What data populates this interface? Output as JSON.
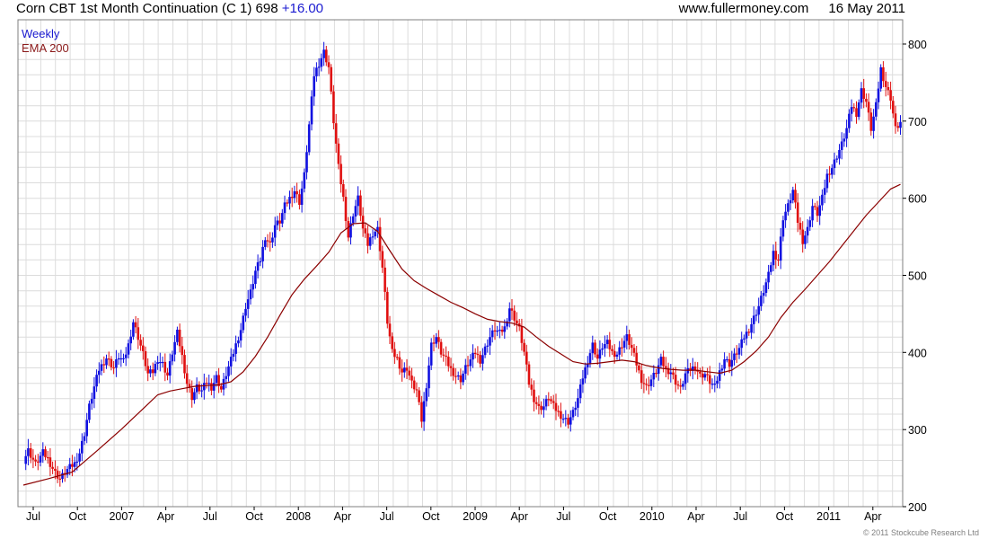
{
  "header": {
    "title": "Corn CBT 1st Month Continuation (C 1)",
    "last": "698",
    "change": "+16.00",
    "site": "www.fullermoney.com",
    "date": "16 May 2011"
  },
  "legend": {
    "period": "Weekly",
    "ema": "EMA 200"
  },
  "copyright": "© 2011 Stockcube Research Ltd",
  "colors": {
    "up": "#1010e0",
    "down": "#e01010",
    "ema": "#8b0000",
    "grid": "#dcdcdc",
    "legend_period": "#1a1ad0",
    "legend_ema": "#8b1a1a"
  },
  "chart_data": {
    "type": "candlestick",
    "ylim": [
      200,
      800
    ],
    "yticks": [
      200,
      300,
      400,
      500,
      600,
      700,
      800
    ],
    "xticks": [
      "Jul",
      "Oct",
      "2007",
      "Apr",
      "Jul",
      "Oct",
      "2008",
      "Apr",
      "Jul",
      "Oct",
      "2009",
      "Apr",
      "Jul",
      "Oct",
      "2010",
      "Apr",
      "Jul",
      "Oct",
      "2011",
      "Apr"
    ],
    "close_path": [
      [
        0,
        260
      ],
      [
        2,
        273
      ],
      [
        5,
        255
      ],
      [
        8,
        270
      ],
      [
        10,
        262
      ],
      [
        13,
        244
      ],
      [
        15,
        236
      ],
      [
        18,
        248
      ],
      [
        21,
        256
      ],
      [
        23,
        270
      ],
      [
        25,
        295
      ],
      [
        27,
        330
      ],
      [
        29,
        355
      ],
      [
        31,
        378
      ],
      [
        34,
        393
      ],
      [
        37,
        380
      ],
      [
        39,
        395
      ],
      [
        41,
        388
      ],
      [
        43,
        410
      ],
      [
        45,
        440
      ],
      [
        47,
        420
      ],
      [
        49,
        398
      ],
      [
        51,
        372
      ],
      [
        53,
        375
      ],
      [
        55,
        392
      ],
      [
        57,
        385
      ],
      [
        59,
        370
      ],
      [
        61,
        400
      ],
      [
        63,
        425
      ],
      [
        65,
        395
      ],
      [
        67,
        360
      ],
      [
        69,
        342
      ],
      [
        71,
        355
      ],
      [
        73,
        350
      ],
      [
        75,
        362
      ],
      [
        77,
        355
      ],
      [
        79,
        368
      ],
      [
        81,
        352
      ],
      [
        83,
        372
      ],
      [
        85,
        390
      ],
      [
        87,
        410
      ],
      [
        89,
        430
      ],
      [
        91,
        460
      ],
      [
        93,
        478
      ],
      [
        95,
        505
      ],
      [
        97,
        520
      ],
      [
        99,
        550
      ],
      [
        101,
        540
      ],
      [
        103,
        565
      ],
      [
        105,
        570
      ],
      [
        107,
        590
      ],
      [
        109,
        600
      ],
      [
        111,
        610
      ],
      [
        113,
        595
      ],
      [
        115,
        630
      ],
      [
        117,
        695
      ],
      [
        119,
        760
      ],
      [
        121,
        775
      ],
      [
        123,
        790
      ],
      [
        125,
        770
      ],
      [
        127,
        700
      ],
      [
        129,
        640
      ],
      [
        131,
        600
      ],
      [
        133,
        550
      ],
      [
        135,
        580
      ],
      [
        137,
        600
      ],
      [
        139,
        560
      ],
      [
        141,
        540
      ],
      [
        143,
        555
      ],
      [
        145,
        560
      ],
      [
        147,
        510
      ],
      [
        149,
        440
      ],
      [
        151,
        400
      ],
      [
        153,
        392
      ],
      [
        155,
        375
      ],
      [
        157,
        380
      ],
      [
        159,
        360
      ],
      [
        161,
        350
      ],
      [
        163,
        312
      ],
      [
        165,
        358
      ],
      [
        167,
        410
      ],
      [
        169,
        420
      ],
      [
        171,
        400
      ],
      [
        173,
        390
      ],
      [
        175,
        378
      ],
      [
        177,
        370
      ],
      [
        179,
        365
      ],
      [
        181,
        380
      ],
      [
        183,
        390
      ],
      [
        185,
        400
      ],
      [
        187,
        390
      ],
      [
        189,
        405
      ],
      [
        191,
        420
      ],
      [
        193,
        430
      ],
      [
        195,
        425
      ],
      [
        197,
        432
      ],
      [
        199,
        458
      ],
      [
        201,
        445
      ],
      [
        203,
        430
      ],
      [
        205,
        400
      ],
      [
        207,
        360
      ],
      [
        209,
        340
      ],
      [
        211,
        328
      ],
      [
        213,
        330
      ],
      [
        215,
        342
      ],
      [
        217,
        330
      ],
      [
        219,
        322
      ],
      [
        221,
        315
      ],
      [
        223,
        310
      ],
      [
        225,
        322
      ],
      [
        227,
        340
      ],
      [
        229,
        368
      ],
      [
        231,
        390
      ],
      [
        233,
        410
      ],
      [
        235,
        392
      ],
      [
        237,
        408
      ],
      [
        239,
        412
      ],
      [
        241,
        400
      ],
      [
        243,
        398
      ],
      [
        245,
        410
      ],
      [
        247,
        420
      ],
      [
        249,
        405
      ],
      [
        251,
        385
      ],
      [
        253,
        365
      ],
      [
        255,
        355
      ],
      [
        257,
        365
      ],
      [
        259,
        375
      ],
      [
        261,
        390
      ],
      [
        263,
        378
      ],
      [
        265,
        375
      ],
      [
        267,
        362
      ],
      [
        269,
        352
      ],
      [
        271,
        372
      ],
      [
        273,
        378
      ],
      [
        275,
        382
      ],
      [
        277,
        370
      ],
      [
        279,
        372
      ],
      [
        281,
        362
      ],
      [
        283,
        355
      ],
      [
        285,
        375
      ],
      [
        287,
        392
      ],
      [
        289,
        385
      ],
      [
        291,
        395
      ],
      [
        293,
        405
      ],
      [
        295,
        420
      ],
      [
        297,
        430
      ],
      [
        299,
        445
      ],
      [
        301,
        460
      ],
      [
        303,
        480
      ],
      [
        305,
        500
      ],
      [
        307,
        530
      ],
      [
        309,
        520
      ],
      [
        311,
        575
      ],
      [
        313,
        590
      ],
      [
        315,
        610
      ],
      [
        317,
        570
      ],
      [
        319,
        545
      ],
      [
        321,
        560
      ],
      [
        323,
        590
      ],
      [
        325,
        580
      ],
      [
        327,
        600
      ],
      [
        329,
        630
      ],
      [
        331,
        640
      ],
      [
        333,
        655
      ],
      [
        335,
        670
      ],
      [
        337,
        690
      ],
      [
        339,
        720
      ],
      [
        341,
        710
      ],
      [
        343,
        740
      ],
      [
        345,
        725
      ],
      [
        347,
        690
      ],
      [
        349,
        720
      ],
      [
        351,
        768
      ],
      [
        353,
        745
      ],
      [
        355,
        730
      ],
      [
        357,
        690
      ],
      [
        359,
        698
      ]
    ],
    "ema_path": [
      [
        0,
        228
      ],
      [
        10,
        236
      ],
      [
        20,
        245
      ],
      [
        30,
        272
      ],
      [
        40,
        300
      ],
      [
        50,
        330
      ],
      [
        55,
        345
      ],
      [
        60,
        350
      ],
      [
        65,
        353
      ],
      [
        70,
        356
      ],
      [
        75,
        357
      ],
      [
        80,
        358
      ],
      [
        85,
        362
      ],
      [
        90,
        375
      ],
      [
        95,
        395
      ],
      [
        100,
        420
      ],
      [
        105,
        448
      ],
      [
        110,
        475
      ],
      [
        115,
        495
      ],
      [
        120,
        512
      ],
      [
        125,
        530
      ],
      [
        130,
        555
      ],
      [
        135,
        567
      ],
      [
        140,
        568
      ],
      [
        145,
        557
      ],
      [
        150,
        532
      ],
      [
        155,
        508
      ],
      [
        160,
        493
      ],
      [
        165,
        483
      ],
      [
        170,
        474
      ],
      [
        175,
        465
      ],
      [
        180,
        458
      ],
      [
        185,
        450
      ],
      [
        190,
        443
      ],
      [
        195,
        440
      ],
      [
        200,
        438
      ],
      [
        205,
        433
      ],
      [
        210,
        420
      ],
      [
        215,
        408
      ],
      [
        220,
        398
      ],
      [
        225,
        388
      ],
      [
        230,
        385
      ],
      [
        235,
        386
      ],
      [
        240,
        388
      ],
      [
        245,
        390
      ],
      [
        250,
        388
      ],
      [
        255,
        383
      ],
      [
        260,
        380
      ],
      [
        265,
        378
      ],
      [
        270,
        377
      ],
      [
        275,
        377
      ],
      [
        280,
        375
      ],
      [
        285,
        373
      ],
      [
        290,
        377
      ],
      [
        295,
        388
      ],
      [
        300,
        402
      ],
      [
        305,
        420
      ],
      [
        310,
        445
      ],
      [
        315,
        465
      ],
      [
        320,
        482
      ],
      [
        325,
        500
      ],
      [
        330,
        518
      ],
      [
        335,
        538
      ],
      [
        340,
        558
      ],
      [
        345,
        578
      ],
      [
        350,
        595
      ],
      [
        355,
        612
      ],
      [
        359,
        618
      ]
    ]
  }
}
